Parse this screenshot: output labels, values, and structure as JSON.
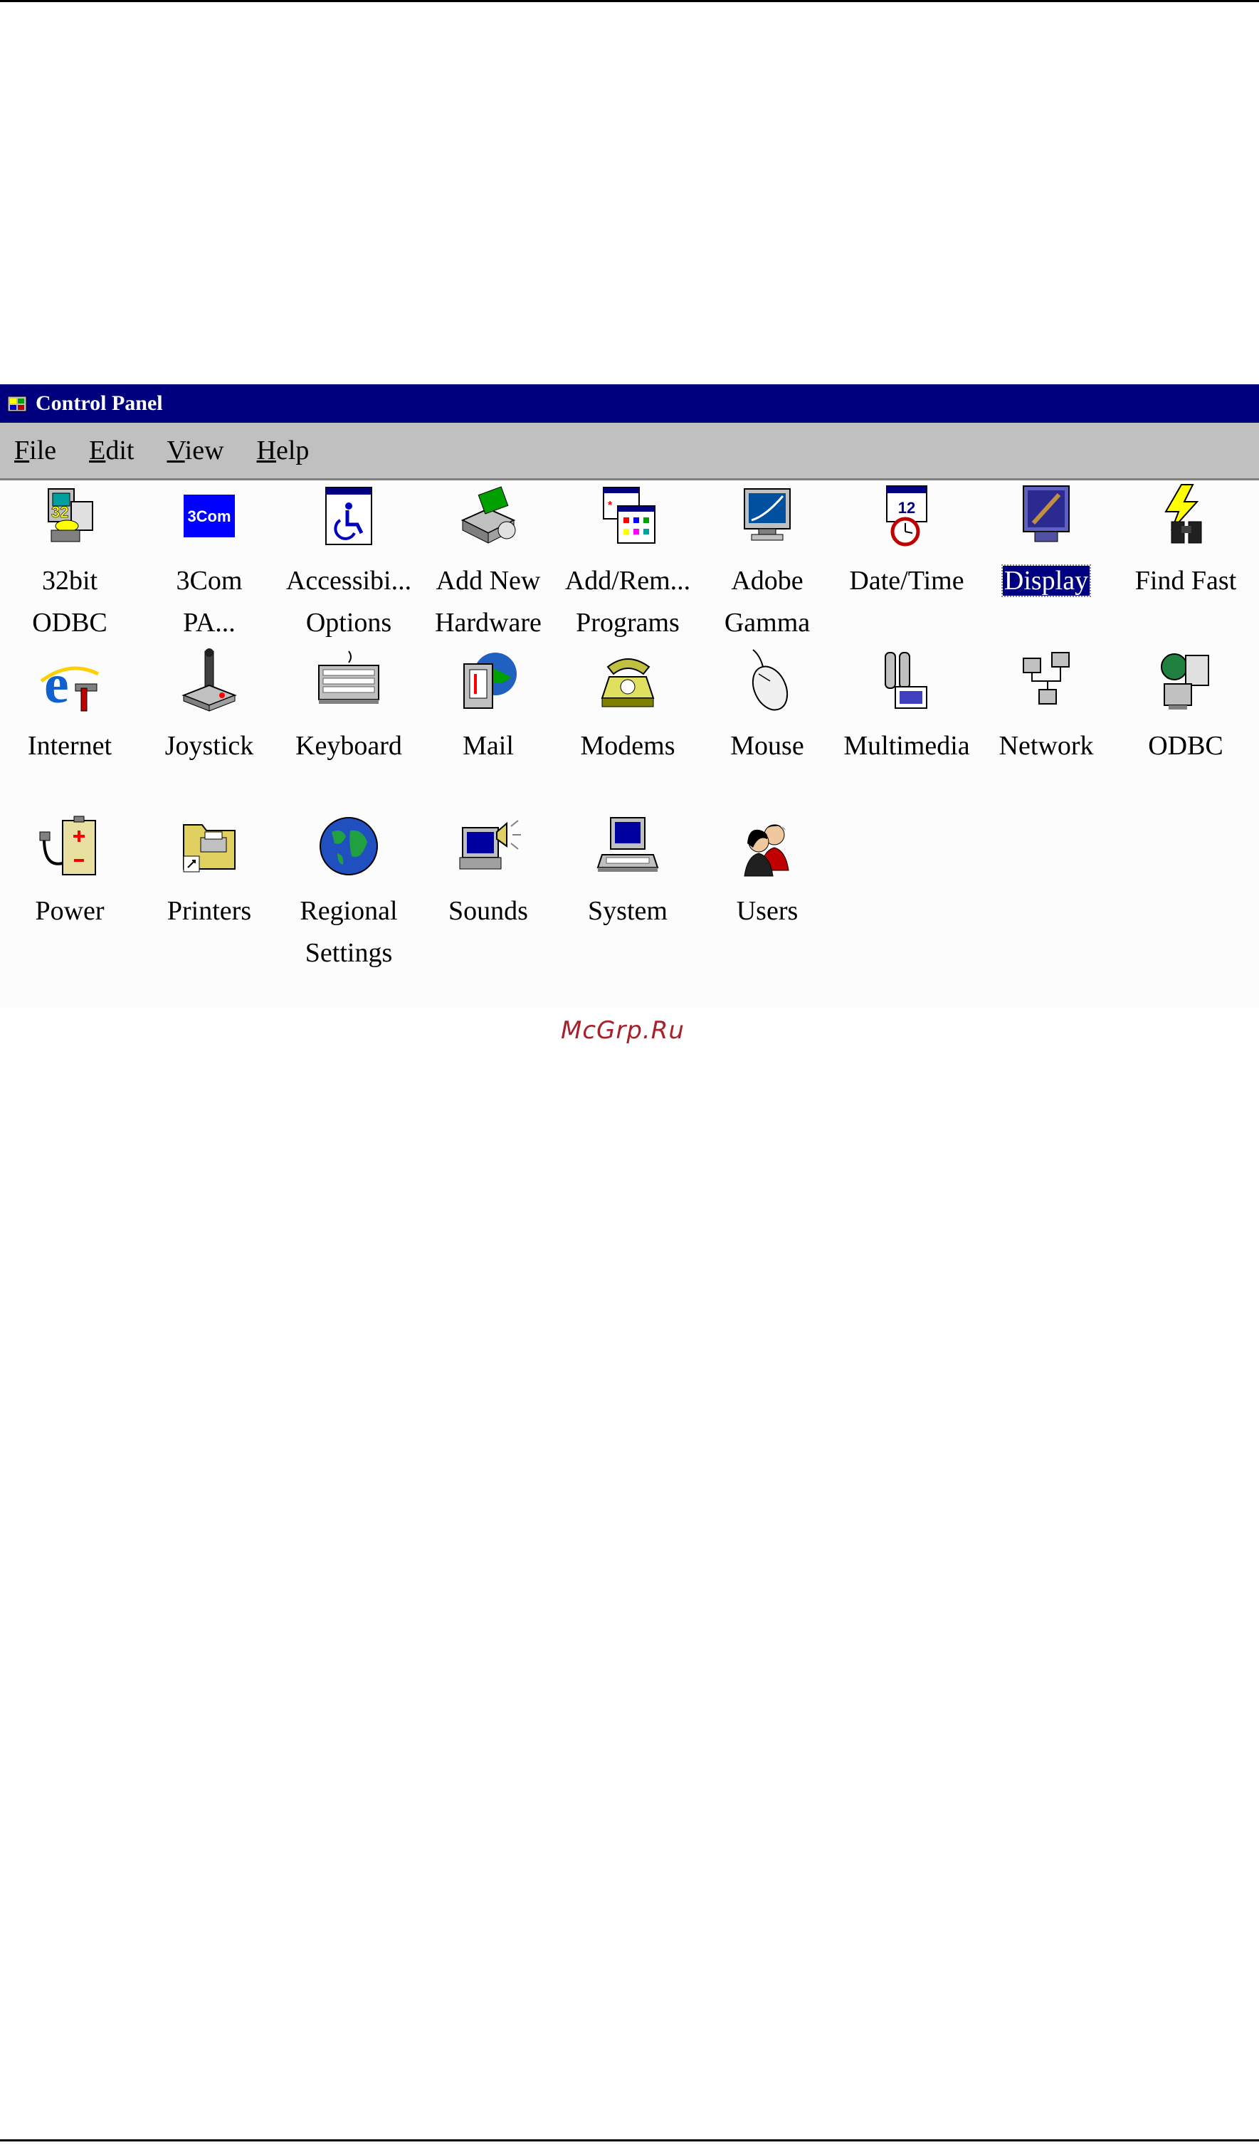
{
  "window": {
    "title": "Control Panel",
    "menu": [
      {
        "accel": "F",
        "rest": "ile"
      },
      {
        "accel": "E",
        "rest": "dit"
      },
      {
        "accel": "V",
        "rest": "iew"
      },
      {
        "accel": "H",
        "rest": "elp"
      }
    ]
  },
  "icons": [
    {
      "label": "32bit\nODBC",
      "icon": "odbc-32bit-icon"
    },
    {
      "label": "3Com\nPA...",
      "icon": "3com-icon",
      "logo_text": "3Com"
    },
    {
      "label": "Accessibi...\nOptions",
      "icon": "accessibility-icon"
    },
    {
      "label": "Add New\nHardware",
      "icon": "add-hardware-icon"
    },
    {
      "label": "Add/Rem...\nPrograms",
      "icon": "add-remove-programs-icon"
    },
    {
      "label": "Adobe\nGamma",
      "icon": "adobe-gamma-icon"
    },
    {
      "label": "Date/Time",
      "icon": "date-time-icon"
    },
    {
      "label": "Display",
      "icon": "display-icon",
      "selected": true
    },
    {
      "label": "Find Fast",
      "icon": "find-fast-icon"
    },
    {
      "label": "Internet",
      "icon": "internet-icon"
    },
    {
      "label": "Joystick",
      "icon": "joystick-icon"
    },
    {
      "label": "Keyboard",
      "icon": "keyboard-icon"
    },
    {
      "label": "Mail",
      "icon": "mail-icon"
    },
    {
      "label": "Modems",
      "icon": "modems-icon"
    },
    {
      "label": "Mouse",
      "icon": "mouse-icon"
    },
    {
      "label": "Multimedia",
      "icon": "multimedia-icon"
    },
    {
      "label": "Network",
      "icon": "network-icon"
    },
    {
      "label": "ODBC",
      "icon": "odbc-icon"
    },
    {
      "label": "Power",
      "icon": "power-icon"
    },
    {
      "label": "Printers",
      "icon": "printers-icon"
    },
    {
      "label": "Regional\nSettings",
      "icon": "regional-settings-icon"
    },
    {
      "label": "Sounds",
      "icon": "sounds-icon"
    },
    {
      "label": "System",
      "icon": "system-icon"
    },
    {
      "label": "Users",
      "icon": "users-icon"
    }
  ],
  "watermark": "McGrp.Ru",
  "colors": {
    "titlebar": "#00007f",
    "menubar": "#c0c0c0",
    "selection": "#000080",
    "watermark": "#a8202a"
  }
}
